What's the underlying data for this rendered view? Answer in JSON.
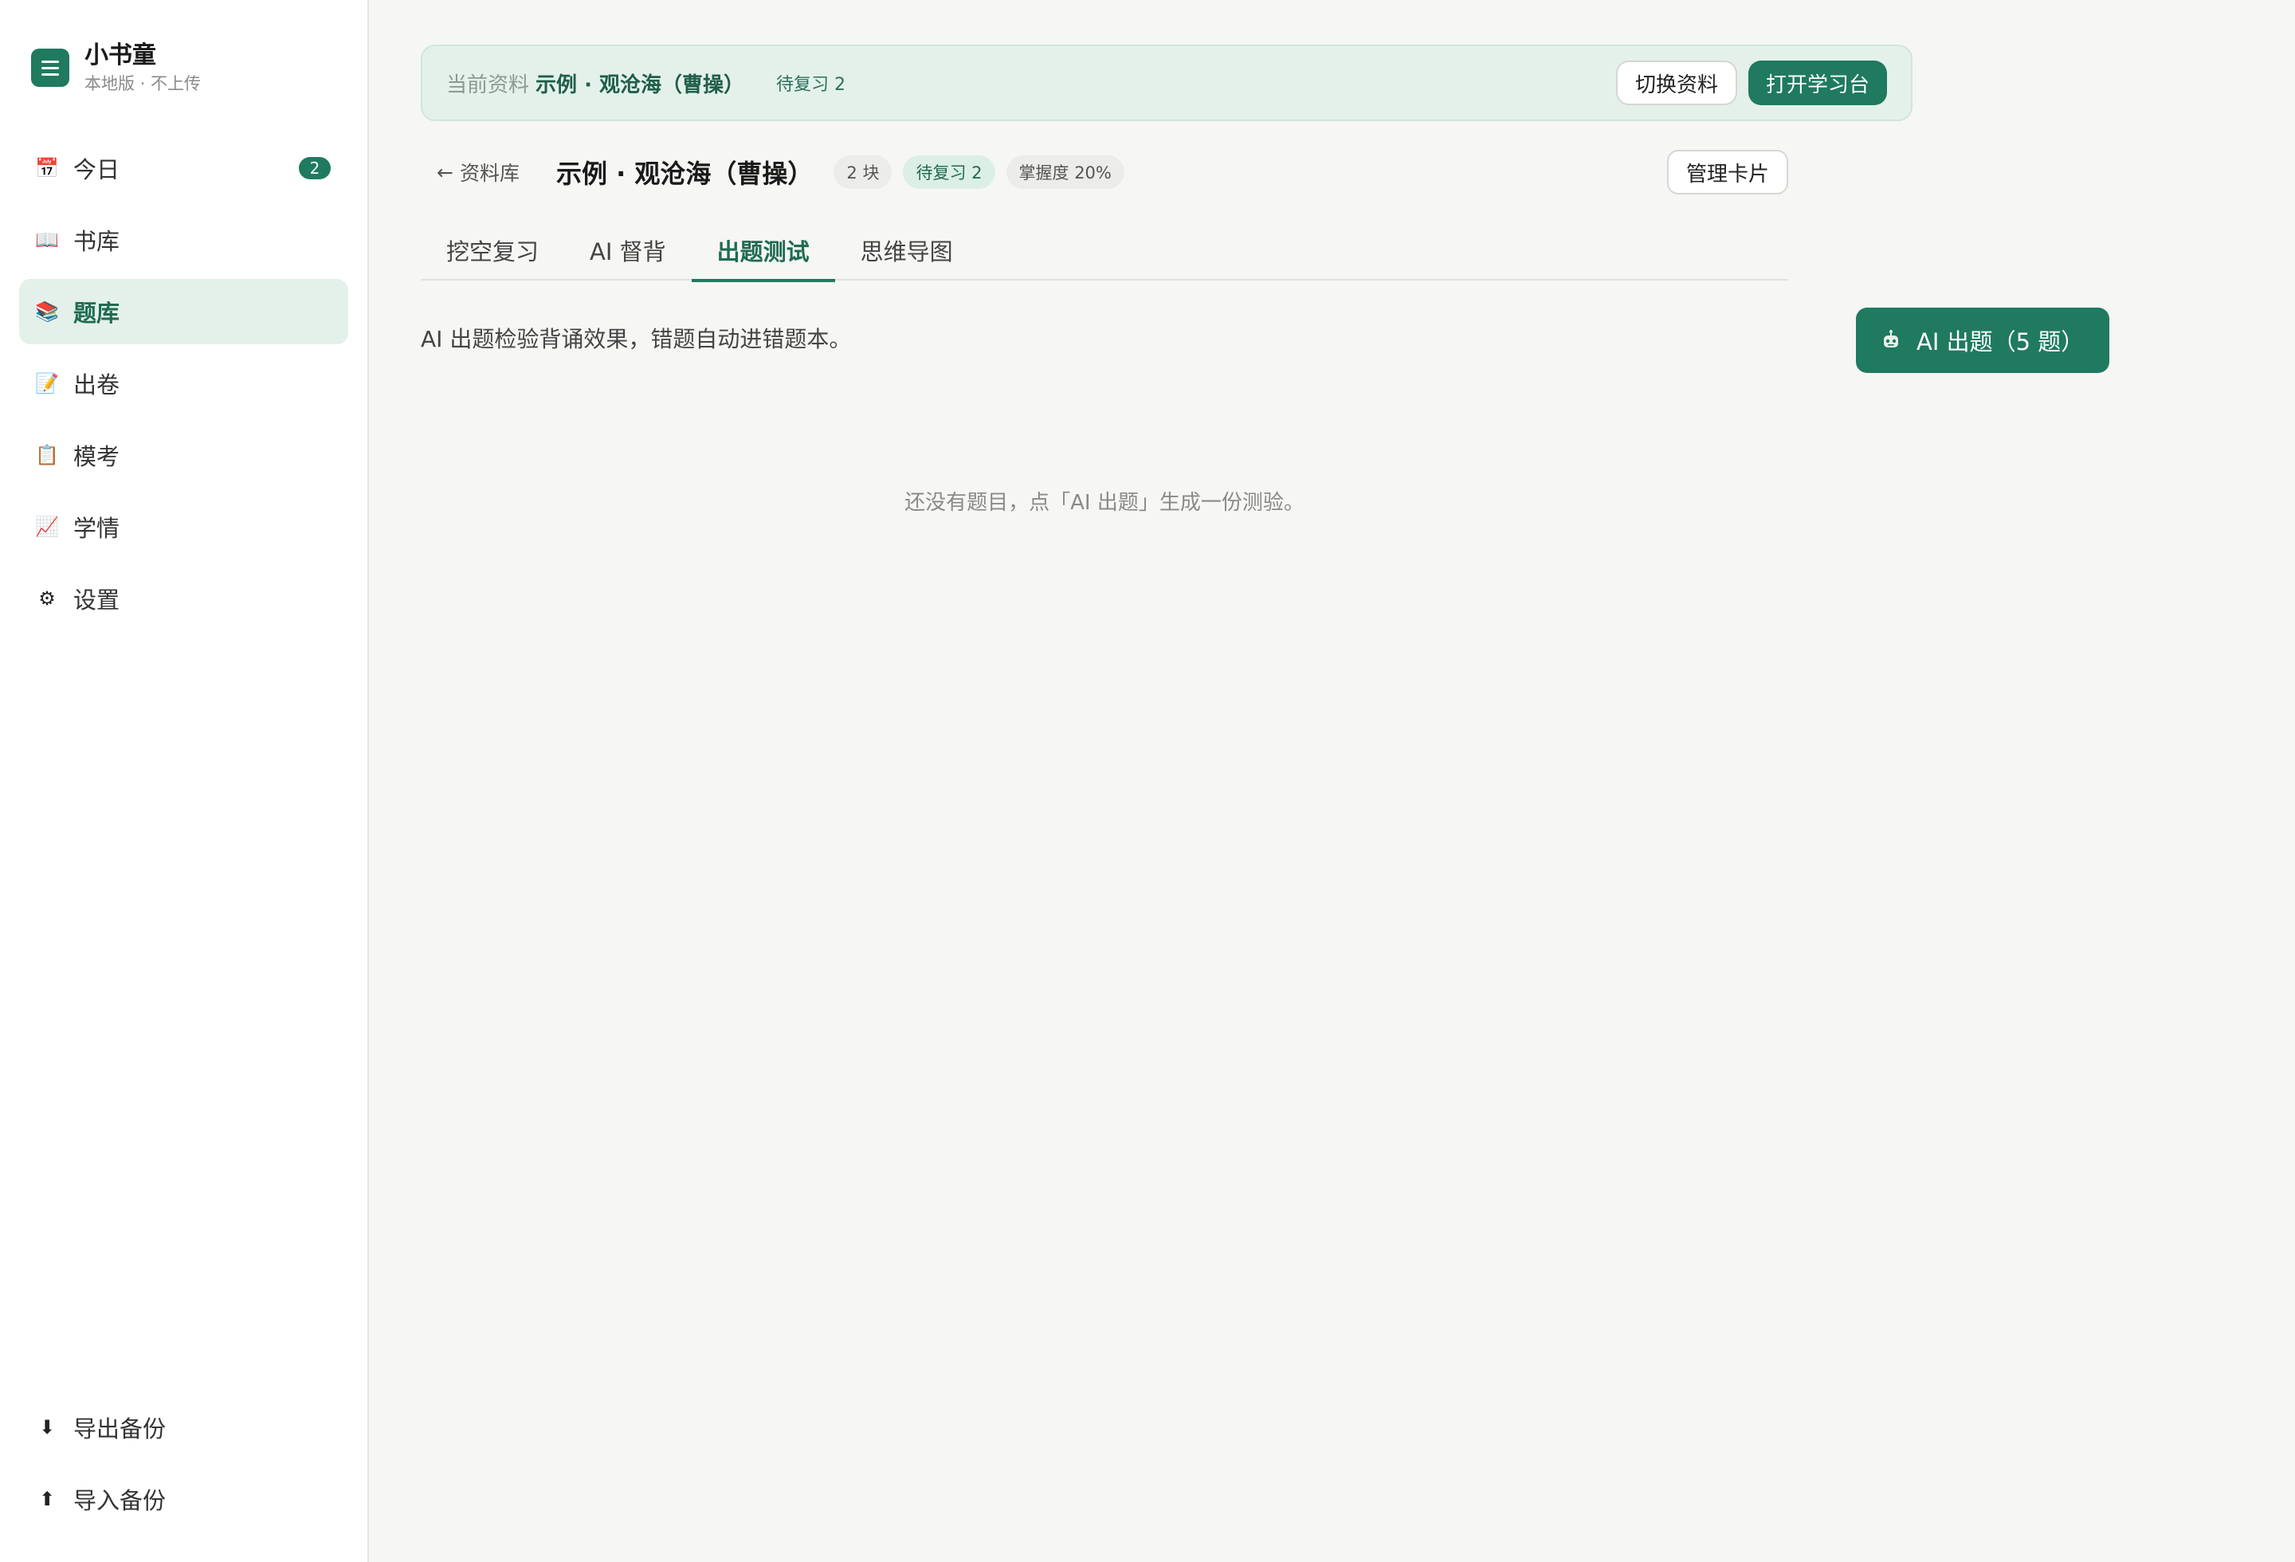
{
  "brand": {
    "name": "小书童",
    "subtitle": "本地版 · 不上传"
  },
  "sidebar": {
    "items": [
      {
        "label": "今日",
        "icon": "calendar-icon",
        "badge": "2"
      },
      {
        "label": "书库",
        "icon": "book-icon"
      },
      {
        "label": "题库",
        "icon": "books-stack-icon",
        "active": true
      },
      {
        "label": "出卷",
        "icon": "memo-icon"
      },
      {
        "label": "模考",
        "icon": "clipboard-icon"
      },
      {
        "label": "学情",
        "icon": "chart-icon"
      },
      {
        "label": "设置",
        "icon": "gear-icon"
      }
    ],
    "bottom": [
      {
        "label": "导出备份",
        "icon": "download-icon"
      },
      {
        "label": "导入备份",
        "icon": "upload-icon"
      }
    ]
  },
  "banner": {
    "label": "当前资料",
    "title": "示例 · 观沧海（曹操）",
    "pending": "待复习 2",
    "switch_label": "切换资料",
    "open_label": "打开学习台"
  },
  "header": {
    "back_label": "资料库",
    "title": "示例 · 观沧海（曹操）",
    "chips": [
      "2 块",
      "待复习 2",
      "掌握度 20%"
    ],
    "manage_label": "管理卡片"
  },
  "tabs": [
    {
      "label": "挖空复习"
    },
    {
      "label": "AI 督背"
    },
    {
      "label": "出题测试",
      "active": true
    },
    {
      "label": "思维导图"
    }
  ],
  "quiz": {
    "description": "AI 出题检验背诵效果，错题自动进错题本。",
    "generate_label": "AI 出题（5 题）",
    "empty_text": "还没有题目，点「AI 出题」生成一份测验。"
  },
  "colors": {
    "accent": "#1f7a5f",
    "accent_light": "#e3f1ea"
  }
}
